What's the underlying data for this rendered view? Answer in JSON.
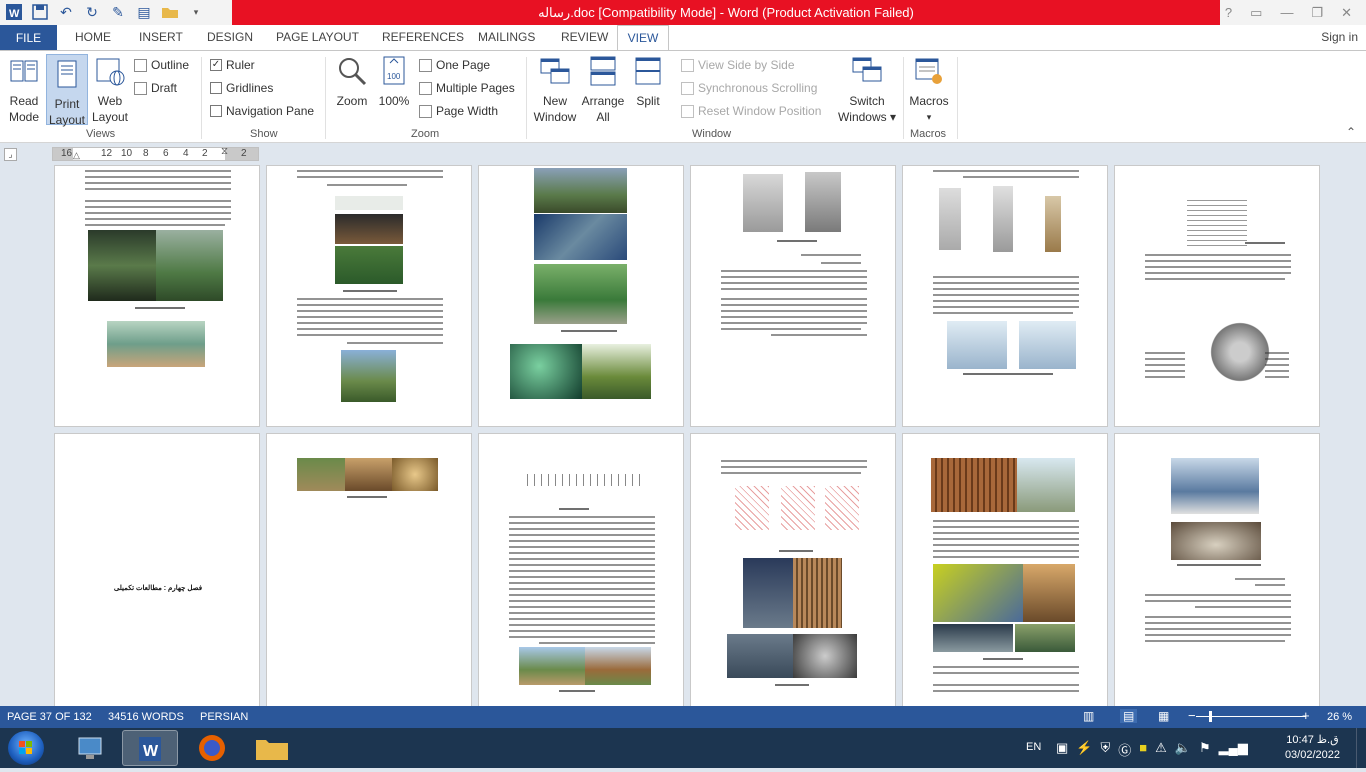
{
  "titlebar": {
    "title": "رساله.doc [Compatibility Mode] -  Word (Product Activation Failed)",
    "help": "?",
    "ribbon_display": "▭",
    "minimize": "—",
    "restore": "❐",
    "close": "✕",
    "qat_icons": [
      "word-icon",
      "save-icon",
      "undo-icon",
      "redo-icon",
      "edit-icon",
      "form-icon",
      "open-folder-icon",
      "customize-icon"
    ]
  },
  "tabs": {
    "file": "FILE",
    "home": "HOME",
    "insert": "INSERT",
    "design": "DESIGN",
    "page_layout": "PAGE LAYOUT",
    "references": "REFERENCES",
    "mailings": "MAILINGS",
    "review": "REVIEW",
    "view": "VIEW",
    "signin": "Sign in"
  },
  "ribbon": {
    "views": {
      "label": "Views",
      "read_mode": [
        "Read",
        "Mode"
      ],
      "print_layout": [
        "Print",
        "Layout"
      ],
      "web_layout": [
        "Web",
        "Layout"
      ],
      "outline": "Outline",
      "draft": "Draft"
    },
    "show": {
      "label": "Show",
      "ruler": "Ruler",
      "ruler_checked": true,
      "gridlines": "Gridlines",
      "navigation_pane": "Navigation Pane"
    },
    "zoom": {
      "label": "Zoom",
      "zoom": "Zoom",
      "hundred": "100%",
      "one_page": "One Page",
      "multiple_pages": "Multiple Pages",
      "page_width": "Page Width"
    },
    "window": {
      "label": "Window",
      "new_window": [
        "New",
        "Window"
      ],
      "arrange_all": [
        "Arrange",
        "All"
      ],
      "split": "Split",
      "view_side_by_side": "View Side by Side",
      "synchronous_scrolling": "Synchronous Scrolling",
      "reset_window_position": "Reset Window Position",
      "switch_windows": [
        "Switch",
        "Windows ▾"
      ]
    },
    "macros": {
      "label": "Macros",
      "macros": "Macros",
      "arrow": "▾"
    },
    "collapse": "⌃"
  },
  "ruler": {
    "ticks": [
      "16",
      "12",
      "10",
      "8",
      "6",
      "4",
      "2",
      "2"
    ]
  },
  "pages": {
    "chapter_heading": "فصل چهارم : مطالعات تکمیلی"
  },
  "status": {
    "page": "PAGE 37 OF 132",
    "words": "34516 WORDS",
    "language": "PERSIAN",
    "zoom_percent": "26 %",
    "zoom_minus": "−",
    "zoom_plus": "+",
    "zoom_level": 26
  },
  "taskbar": {
    "lang": "EN",
    "time": "10:47 ق.ظ",
    "date": "03/02/2022"
  },
  "colors": {
    "accent": "#2b579a",
    "activation_bar": "#e81123",
    "taskbar": "#1c3550"
  }
}
